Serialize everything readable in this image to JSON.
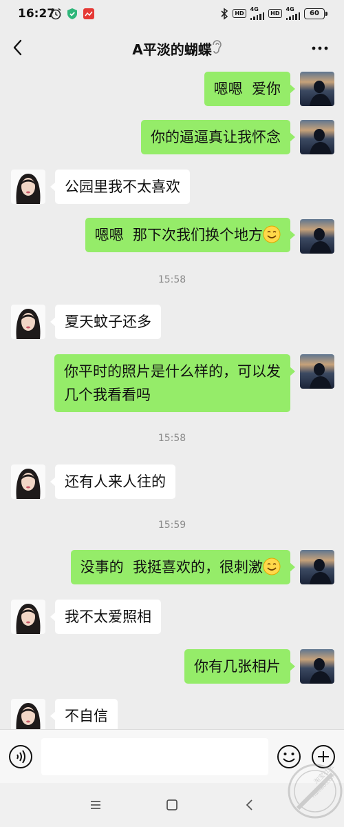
{
  "status_bar": {
    "time": "16:27",
    "network_1": "4G",
    "network_2": "4G",
    "hd": "HD",
    "battery": "60"
  },
  "header": {
    "title": "A平淡的蝴蝶"
  },
  "messages": [
    {
      "type": "out",
      "text": "嗯嗯  爱你"
    },
    {
      "type": "out",
      "text": "你的逼逼真让我怀念"
    },
    {
      "type": "in",
      "text": "公园里我不太喜欢"
    },
    {
      "type": "out",
      "text": "嗯嗯  那下次我们换个地方",
      "emoji": "smile"
    },
    {
      "type": "time",
      "text": "15:58"
    },
    {
      "type": "in",
      "text": "夏天蚊子还多"
    },
    {
      "type": "out",
      "text": "你平时的照片是什么样的，可以发\n几个我看看吗"
    },
    {
      "type": "time",
      "text": "15:58"
    },
    {
      "type": "in",
      "text": "还有人来人往的"
    },
    {
      "type": "time",
      "text": "15:59"
    },
    {
      "type": "out",
      "text": "没事的  我挺喜欢的，很刺激",
      "emoji": "smile"
    },
    {
      "type": "in",
      "text": "我不太爱照相"
    },
    {
      "type": "out",
      "text": "你有几张相片"
    },
    {
      "type": "in",
      "text": "不自信"
    }
  ],
  "input_bar": {
    "placeholder": ""
  },
  "watermark": {
    "text_cn": "淘宝社区",
    "text_en": "hailiao.com"
  },
  "colors": {
    "background": "#ededed",
    "outgoing_bubble": "#95ec69",
    "incoming_bubble": "#ffffff",
    "timestamp": "#8a8a8a"
  }
}
